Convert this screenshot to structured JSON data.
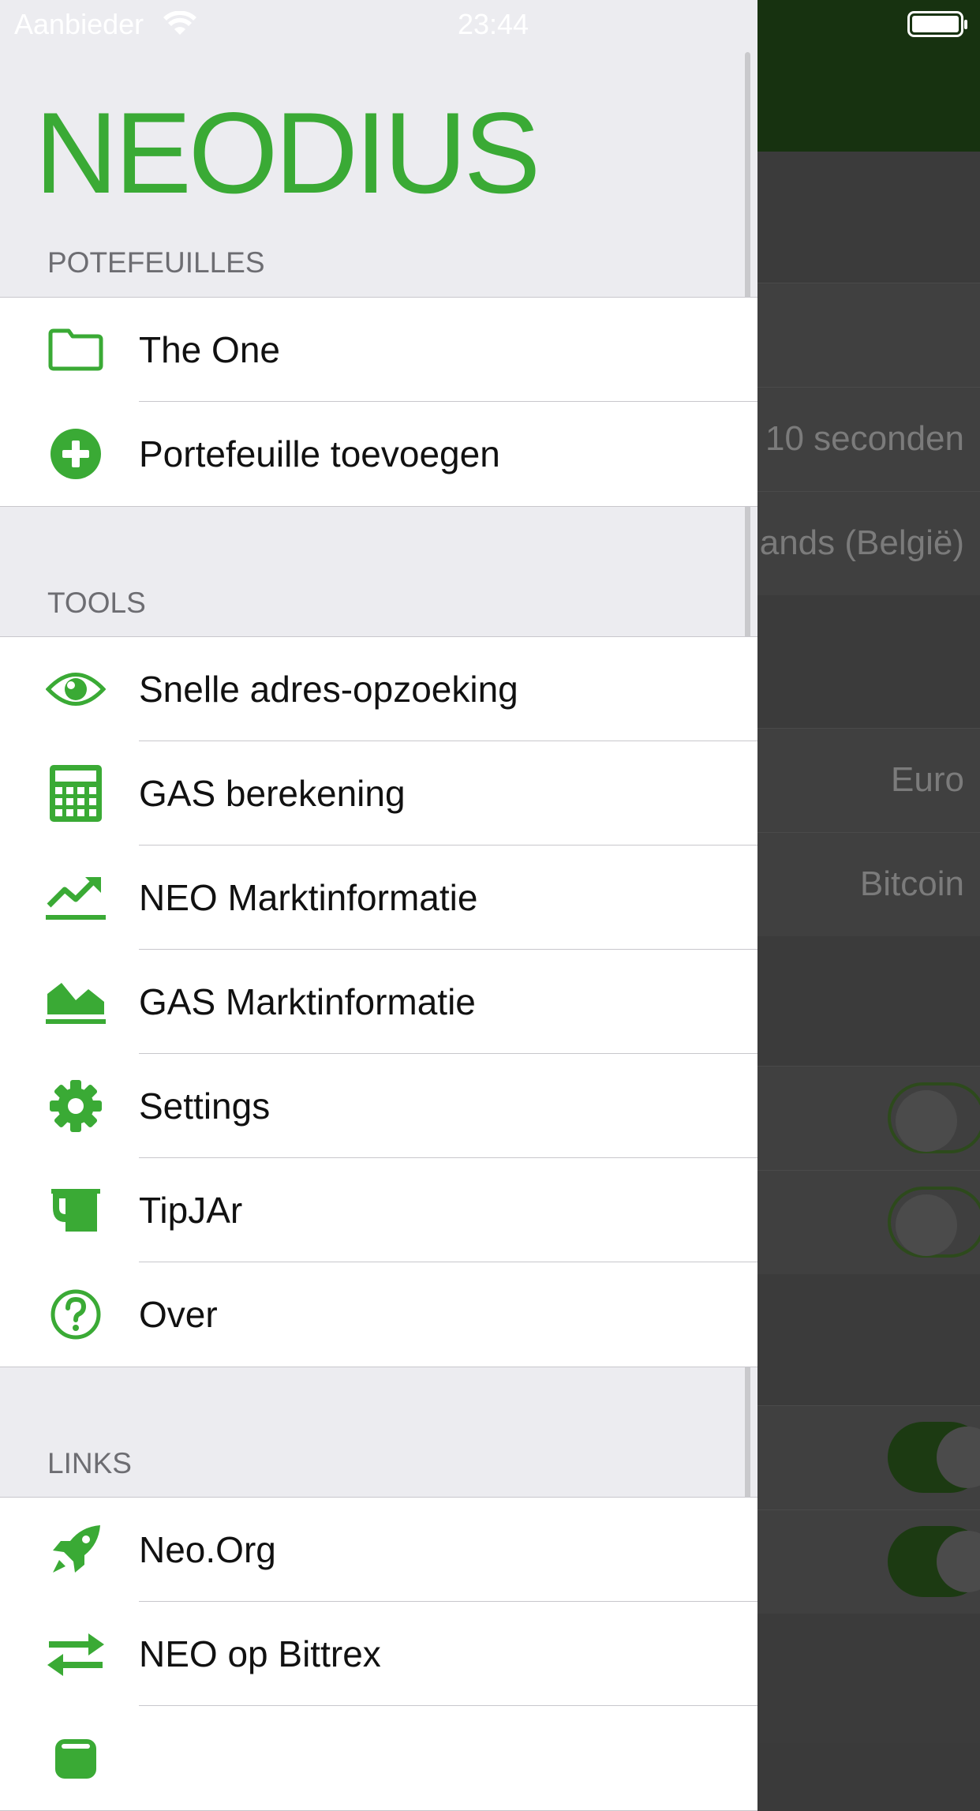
{
  "status_bar": {
    "carrier": "Aanbieder",
    "time": "23:44"
  },
  "app": {
    "logo": "NEODIUS",
    "accent_color": "#3aaa35"
  },
  "sections": {
    "portfolios": {
      "title": "POTEFEUILLES",
      "items": [
        {
          "label": "The One",
          "icon": "folder-icon"
        },
        {
          "label": "Portefeuille toevoegen",
          "icon": "plus-circle-icon"
        }
      ]
    },
    "tools": {
      "title": "TOOLS",
      "items": [
        {
          "label": "Snelle adres-opzoeking",
          "icon": "eye-icon"
        },
        {
          "label": "GAS berekening",
          "icon": "calculator-icon"
        },
        {
          "label": "NEO Marktinformatie",
          "icon": "line-chart-icon"
        },
        {
          "label": "GAS Marktinformatie",
          "icon": "area-chart-icon"
        },
        {
          "label": "Settings",
          "icon": "gear-icon"
        },
        {
          "label": "TipJAr",
          "icon": "tip-jar-icon"
        },
        {
          "label": "Over",
          "icon": "question-circle-icon"
        }
      ]
    },
    "links": {
      "title": "LINKS",
      "items": [
        {
          "label": "Neo.Org",
          "icon": "rocket-icon"
        },
        {
          "label": "NEO op Bittrex",
          "icon": "exchange-icon"
        },
        {
          "label": "",
          "icon": "database-icon"
        }
      ]
    }
  },
  "background": {
    "refresh_value": "10 seconden",
    "language_value": "ands (België)",
    "currency_1": "Euro",
    "currency_2": "Bitcoin"
  }
}
